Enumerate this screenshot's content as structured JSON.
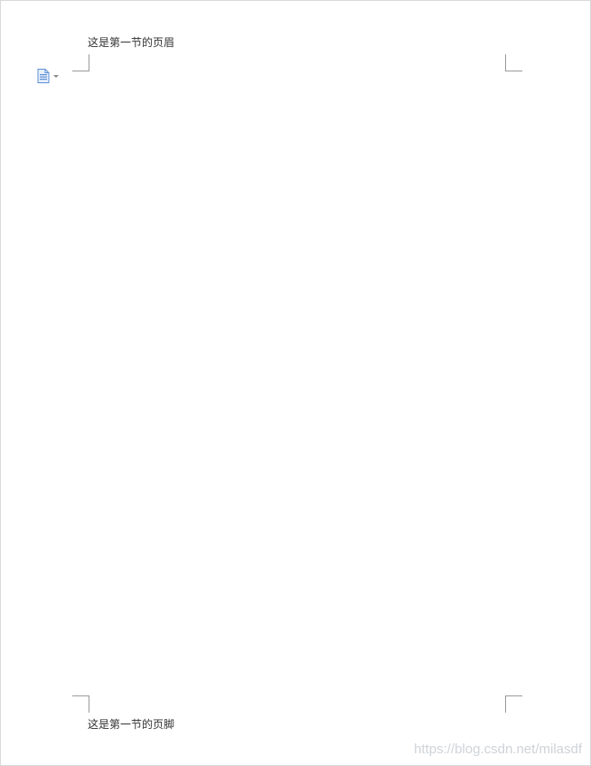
{
  "header": {
    "text": "这是第一节的页眉"
  },
  "footer": {
    "text": "这是第一节的页脚"
  },
  "paste_options": {
    "icon": "document-icon",
    "dropdown_icon": "chevron-down-icon",
    "accent_color": "#5b8fd6"
  },
  "watermark": {
    "text": "https://blog.csdn.net/milasdf"
  }
}
